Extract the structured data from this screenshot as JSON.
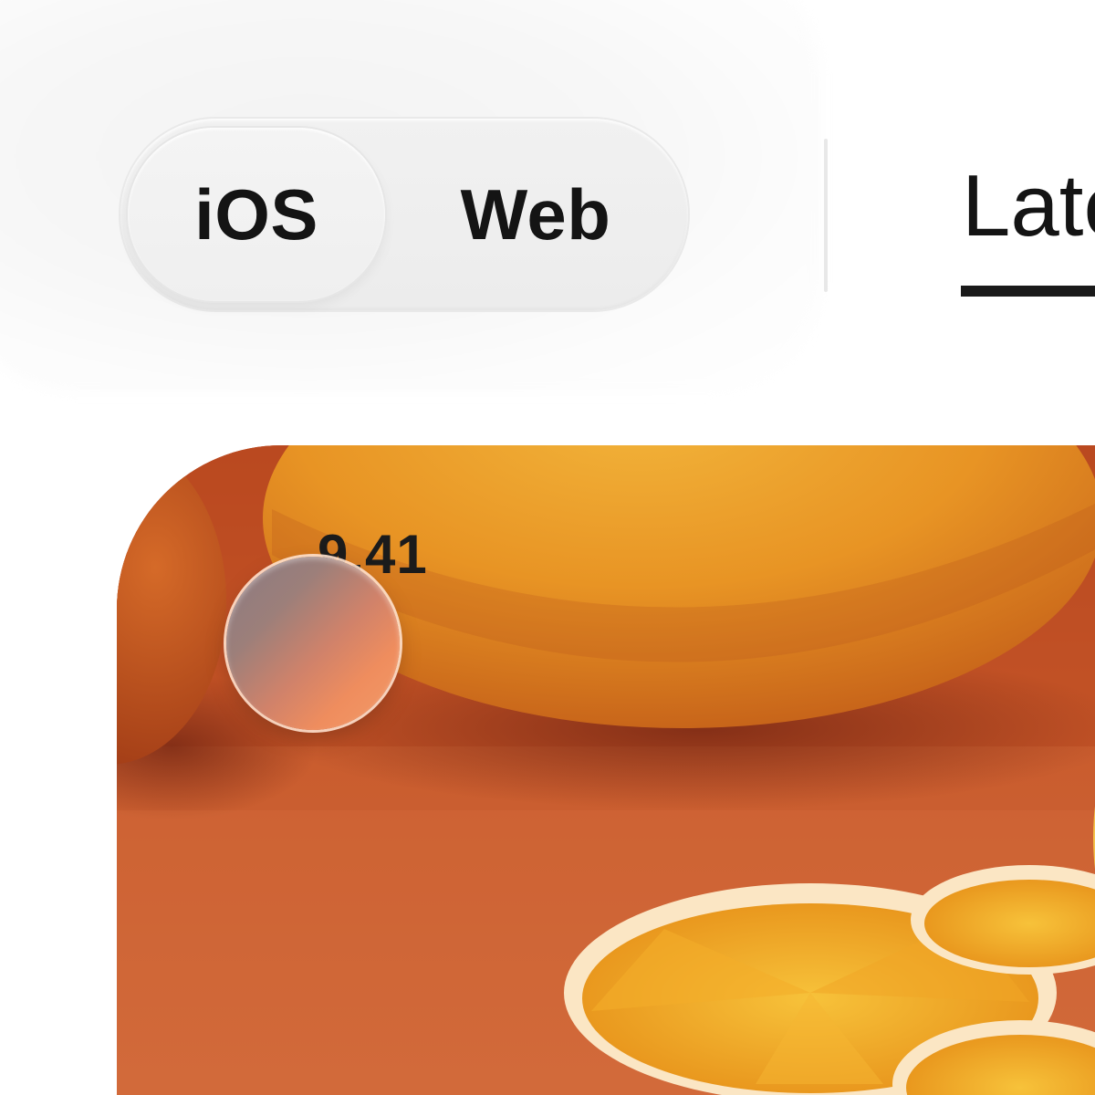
{
  "platform_toggle": {
    "options": [
      "iOS",
      "Web"
    ],
    "selected": "iOS"
  },
  "tabs": {
    "active_label": "Late"
  },
  "photo": {
    "subject": "oranges-photo"
  },
  "slider": {
    "value_text": "9.41"
  }
}
